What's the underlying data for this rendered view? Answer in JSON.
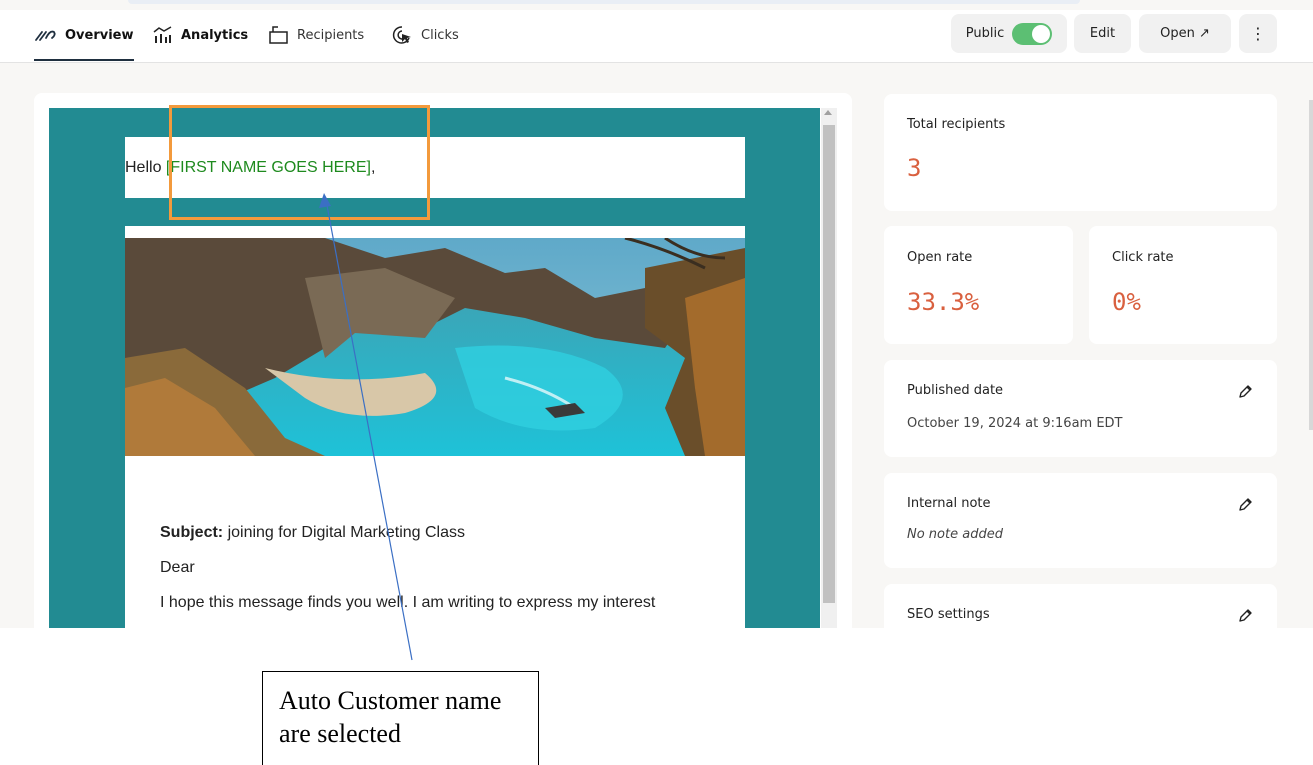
{
  "nav": {
    "tabs": [
      {
        "label": "Overview",
        "icon": "overview-icon",
        "active": true
      },
      {
        "label": "Analytics",
        "icon": "analytics-icon"
      },
      {
        "label": "Recipients",
        "icon": "recipients-icon"
      },
      {
        "label": "Clicks",
        "icon": "clicks-icon"
      }
    ],
    "public_label": "Public",
    "public_toggle_on": true,
    "edit_label": "Edit",
    "open_label": "Open ↗",
    "more_label": "⋮"
  },
  "email": {
    "greeting_prefix": "Hello ",
    "greeting_merge": "[FIRST NAME GOES HERE]",
    "greeting_suffix": ",",
    "subject_label": "Subject:",
    "subject_text": " joining for Digital Marketing Class",
    "salutation": "Dear",
    "body_line": "I hope this message finds you well. I am writing to express my interest"
  },
  "stats": {
    "total_recipients": {
      "label": "Total recipients",
      "value": "3"
    },
    "open_rate": {
      "label": "Open rate",
      "value": "33.3%"
    },
    "click_rate": {
      "label": "Click rate",
      "value": "0%"
    },
    "published": {
      "label": "Published date",
      "value": "October 19, 2024 at 9:16am EDT"
    },
    "internal_note": {
      "label": "Internal note",
      "value": "No note added"
    },
    "seo": {
      "label": "SEO settings"
    }
  },
  "annotation": {
    "callout_text": "Auto Customer name are selected"
  },
  "colors": {
    "teal": "#228b92",
    "accent_metric": "#d9603f",
    "merge_green": "#1e8a1e",
    "highlight_orange": "#f39a3c",
    "toggle_green": "#5cbf73"
  }
}
